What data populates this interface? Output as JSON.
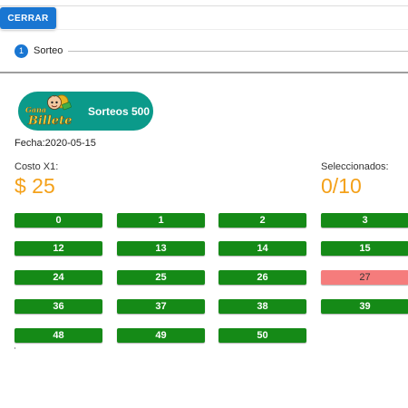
{
  "toolbar": {
    "close_label": "CERRAR"
  },
  "stepper": {
    "step_number": "1",
    "step_label": "Sorteo"
  },
  "brand": {
    "logo_text": "Gana Billete",
    "name": "Sorteos 500"
  },
  "draw": {
    "date": "Fecha:2020-05-15"
  },
  "cost": {
    "label": "Costo X1:",
    "value": "$ 25"
  },
  "selected": {
    "label": "Seleccionados:",
    "value": "0/10"
  },
  "colors": {
    "primary": "#1976d2",
    "available": "#158a17",
    "reserved": "#f57c7c",
    "accent": "#f4a11a",
    "brand": "#0b9a8a"
  },
  "numbers": [
    [
      "0",
      "1",
      "2",
      "3"
    ],
    [
      "12",
      "13",
      "14",
      "15"
    ],
    [
      "24",
      "25",
      "26",
      "27"
    ],
    [
      "36",
      "37",
      "38",
      "39"
    ],
    [
      "48",
      "49",
      "50"
    ]
  ],
  "reserved_numbers": [
    "27"
  ]
}
